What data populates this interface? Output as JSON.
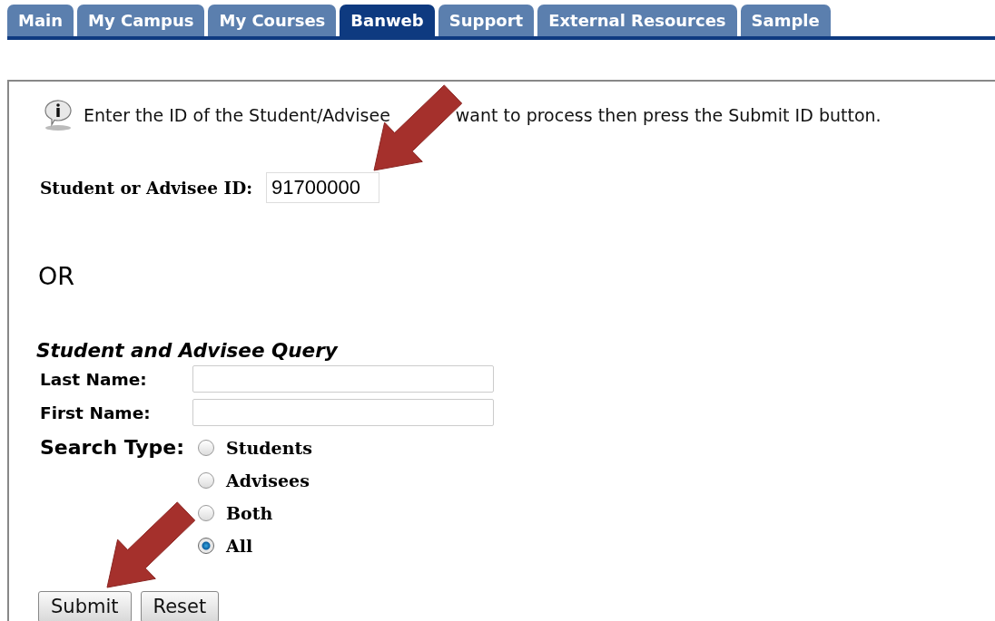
{
  "tabs": [
    {
      "label": "Main",
      "selected": false
    },
    {
      "label": "My Campus",
      "selected": false
    },
    {
      "label": "My Courses",
      "selected": false
    },
    {
      "label": "Banweb",
      "selected": true
    },
    {
      "label": "Support",
      "selected": false
    },
    {
      "label": "External Resources",
      "selected": false
    },
    {
      "label": "Sample",
      "selected": false
    }
  ],
  "instruction": {
    "before": "Enter the ID of the Student/Advisee",
    "after": "want to process then press the Submit ID button."
  },
  "id_field": {
    "label": "Student or Advisee ID:",
    "value": "91700000"
  },
  "or_text": "OR",
  "query": {
    "title": "Student and Advisee Query",
    "fields": [
      {
        "label": "Last Name:"
      },
      {
        "label": "First Name:"
      }
    ],
    "search_type_label": "Search Type:",
    "options": [
      {
        "label": "Students",
        "selected": false
      },
      {
        "label": "Advisees",
        "selected": false
      },
      {
        "label": "Both",
        "selected": false
      },
      {
        "label": "All",
        "selected": true
      }
    ]
  },
  "buttons": [
    "Submit",
    "Reset"
  ]
}
